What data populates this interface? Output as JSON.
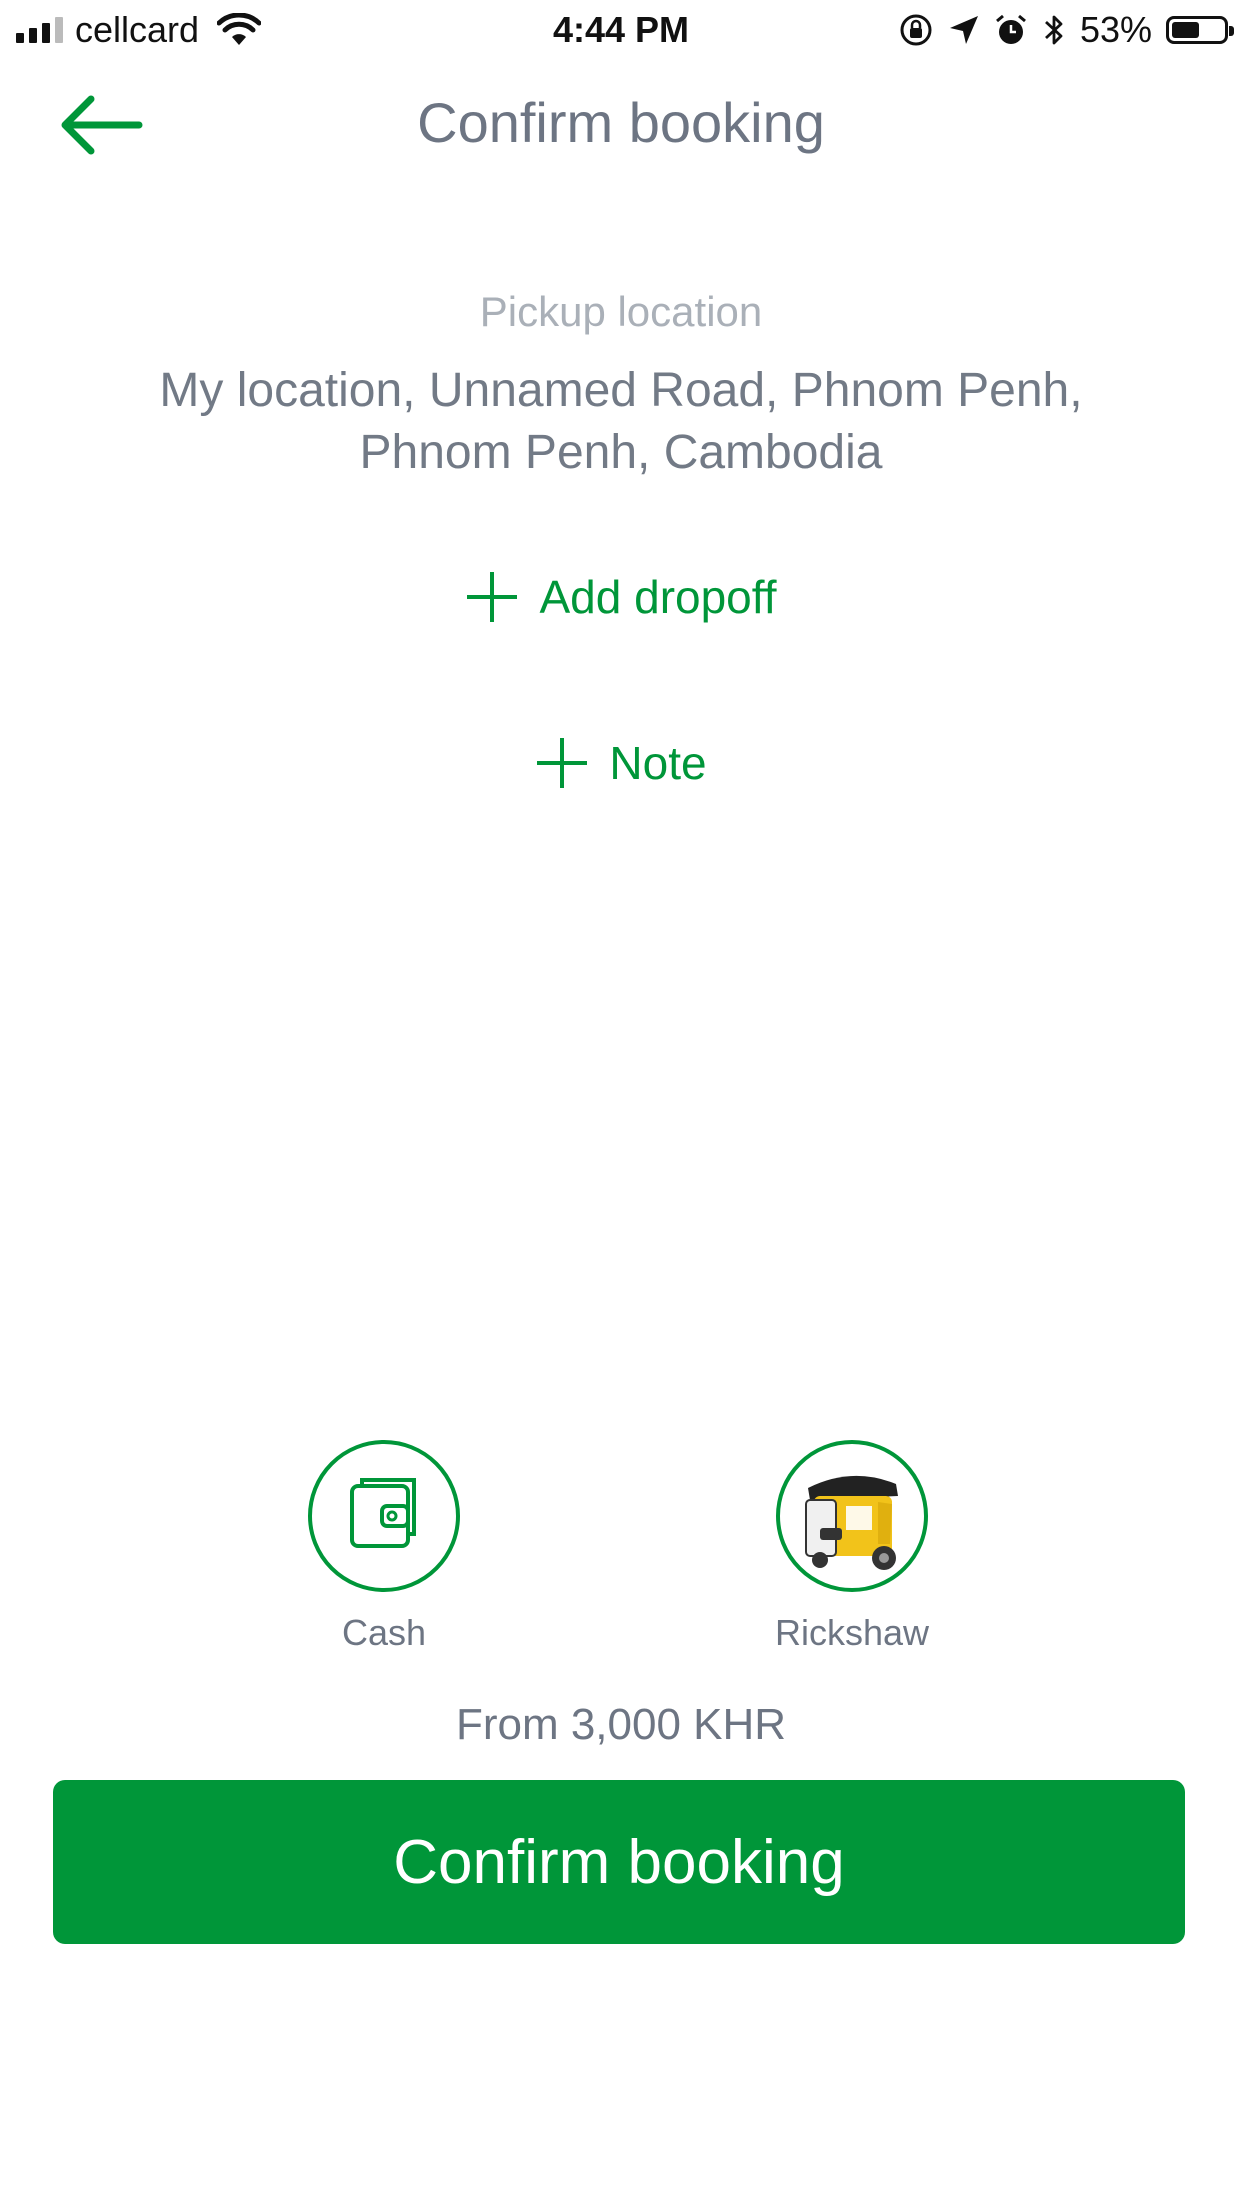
{
  "status_bar": {
    "carrier": "cellcard",
    "time": "4:44 PM",
    "battery": "53%",
    "battery_level": 0.53
  },
  "header": {
    "title": "Confirm booking",
    "back_icon": "arrow-left-icon"
  },
  "pickup": {
    "label": "Pickup location",
    "value": "My location, Unnamed Road, Phnom Penh, Phnom Penh, Cambodia"
  },
  "actions": {
    "add_dropoff": "Add dropoff",
    "note": "Note"
  },
  "payment": {
    "label": "Cash",
    "icon": "wallet-icon"
  },
  "vehicle": {
    "label": "Rickshaw",
    "icon": "rickshaw-image"
  },
  "fare": "From 3,000 KHR",
  "confirm_button": "Confirm booking",
  "colors": {
    "accent": "#009639",
    "text_gray": "#6d7583",
    "label_gray": "#aab0b8"
  }
}
